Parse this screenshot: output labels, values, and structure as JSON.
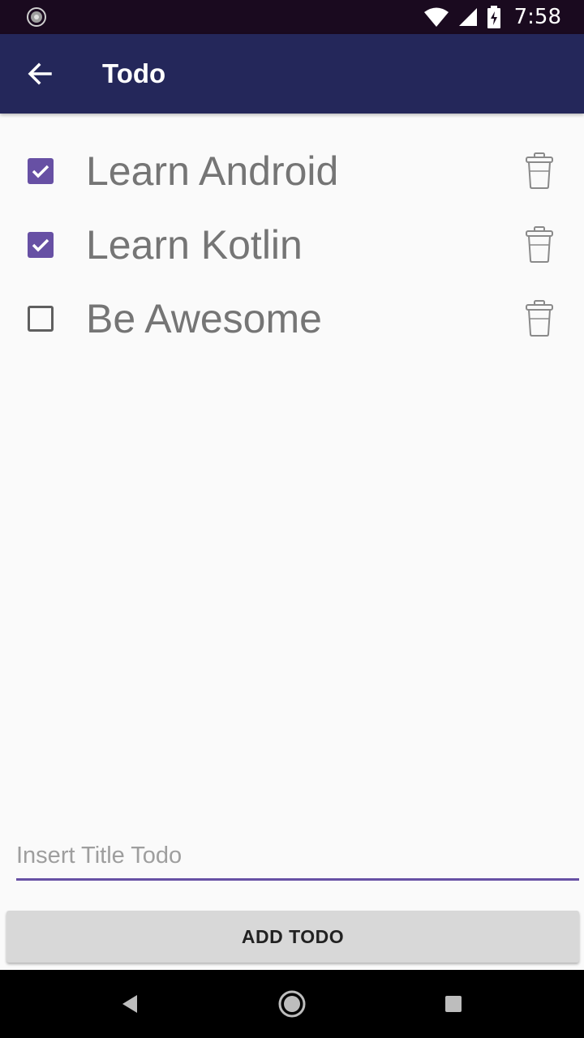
{
  "status_bar": {
    "time": "7:58",
    "icons": [
      "notification-icon",
      "wifi-icon",
      "signal-icon",
      "battery-charging-icon"
    ]
  },
  "app_bar": {
    "title": "Todo",
    "back_icon": "arrow-back-icon"
  },
  "todos": [
    {
      "title": "Learn Android",
      "checked": true
    },
    {
      "title": "Learn Kotlin",
      "checked": true
    },
    {
      "title": "Be Awesome",
      "checked": false
    }
  ],
  "input": {
    "value": "",
    "placeholder": "Insert Title Todo"
  },
  "add_button": {
    "label": "ADD TODO"
  },
  "nav_bar": {
    "icons": [
      "nav-back-icon",
      "nav-home-icon",
      "nav-recents-icon"
    ]
  },
  "colors": {
    "status_bar": "#1a0a1f",
    "app_bar": "#24275a",
    "accent": "#6750a4",
    "todo_text": "#757575",
    "button_bg": "#d8d8d8"
  }
}
